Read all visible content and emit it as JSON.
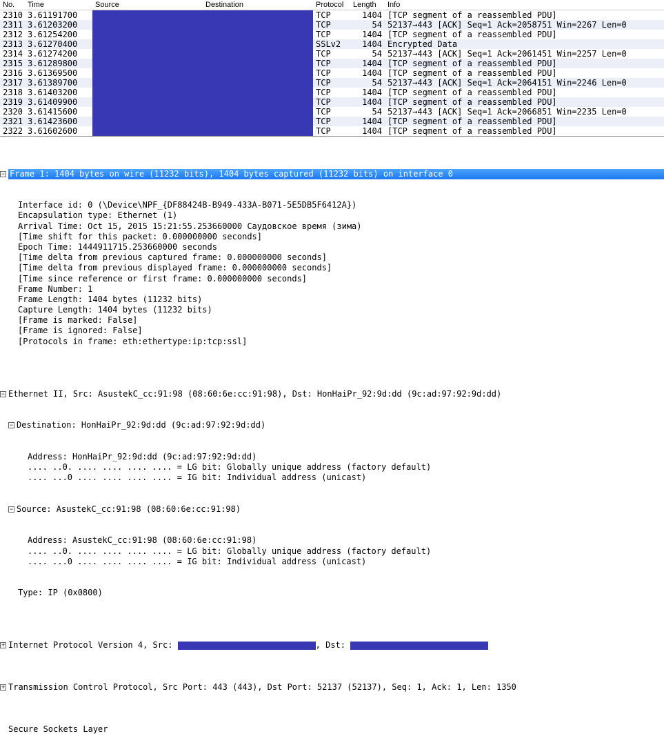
{
  "columns": {
    "no": "No.",
    "time": "Time",
    "source": "Source",
    "destination": "Destination",
    "protocol": "Protocol",
    "length": "Length",
    "info": "Info"
  },
  "packets": [
    {
      "no": "2310",
      "time": "3.61191700",
      "proto": "TCP",
      "len": "1404",
      "info": "[TCP segment of a reassembled PDU]"
    },
    {
      "no": "2311",
      "time": "3.61203200",
      "proto": "TCP",
      "len": "54",
      "info": "52137→443 [ACK] Seq=1 Ack=2058751 Win=2267 Len=0"
    },
    {
      "no": "2312",
      "time": "3.61254200",
      "proto": "TCP",
      "len": "1404",
      "info": "[TCP segment of a reassembled PDU]"
    },
    {
      "no": "2313",
      "time": "3.61270400",
      "proto": "SSLv2",
      "len": "1404",
      "info": "Encrypted Data"
    },
    {
      "no": "2314",
      "time": "3.61274200",
      "proto": "TCP",
      "len": "54",
      "info": "52137→443 [ACK] Seq=1 Ack=2061451 Win=2257 Len=0"
    },
    {
      "no": "2315",
      "time": "3.61289800",
      "proto": "TCP",
      "len": "1404",
      "info": "[TCP segment of a reassembled PDU]"
    },
    {
      "no": "2316",
      "time": "3.61369500",
      "proto": "TCP",
      "len": "1404",
      "info": "[TCP segment of a reassembled PDU]"
    },
    {
      "no": "2317",
      "time": "3.61389700",
      "proto": "TCP",
      "len": "54",
      "info": "52137→443 [ACK] Seq=1 Ack=2064151 Win=2246 Len=0"
    },
    {
      "no": "2318",
      "time": "3.61403200",
      "proto": "TCP",
      "len": "1404",
      "info": "[TCP segment of a reassembled PDU]"
    },
    {
      "no": "2319",
      "time": "3.61409900",
      "proto": "TCP",
      "len": "1404",
      "info": "[TCP segment of a reassembled PDU]"
    },
    {
      "no": "2320",
      "time": "3.61415600",
      "proto": "TCP",
      "len": "54",
      "info": "52137→443 [ACK] Seq=1 Ack=2066851 Win=2235 Len=0"
    },
    {
      "no": "2321",
      "time": "3.61423600",
      "proto": "TCP",
      "len": "1404",
      "info": "[TCP segment of a reassembled PDU]"
    },
    {
      "no": "2322",
      "time": "3.61602600",
      "proto": "TCP",
      "len": "1404",
      "info": "[TCP seqment of a reassembled PDU]"
    }
  ],
  "details": {
    "frame_header": "Frame 1: 1404 bytes on wire (11232 bits), 1404 bytes captured (11232 bits) on interface 0",
    "frame_lines": [
      "Interface id: 0 (\\Device\\NPF_{DF88424B-B949-433A-B071-5E5DB5F6412A})",
      "Encapsulation type: Ethernet (1)",
      "Arrival Time: Oct 15, 2015 15:21:55.253660000 Саудовское время (зима)",
      "[Time shift for this packet: 0.000000000 seconds]",
      "Epoch Time: 1444911715.253660000 seconds",
      "[Time delta from previous captured frame: 0.000000000 seconds]",
      "[Time delta from previous displayed frame: 0.000000000 seconds]",
      "[Time since reference or first frame: 0.000000000 seconds]",
      "Frame Number: 1",
      "Frame Length: 1404 bytes (11232 bits)",
      "Capture Length: 1404 bytes (11232 bits)",
      "[Frame is marked: False]",
      "[Frame is ignored: False]",
      "[Protocols in frame: eth:ethertype:ip:tcp:ssl]"
    ],
    "eth_header": "Ethernet II, Src: AsustekC_cc:91:98 (08:60:6e:cc:91:98), Dst: HonHaiPr_92:9d:dd (9c:ad:97:92:9d:dd)",
    "eth_dst_header": "Destination: HonHaiPr_92:9d:dd (9c:ad:97:92:9d:dd)",
    "eth_dst_lines": [
      "Address: HonHaiPr_92:9d:dd (9c:ad:97:92:9d:dd)",
      ".... ..0. .... .... .... .... = LG bit: Globally unique address (factory default)",
      ".... ...0 .... .... .... .... = IG bit: Individual address (unicast)"
    ],
    "eth_src_header": "Source: AsustekC_cc:91:98 (08:60:6e:cc:91:98)",
    "eth_src_lines": [
      "Address: AsustekC_cc:91:98 (08:60:6e:cc:91:98)",
      ".... ..0. .... .... .... .... = LG bit: Globally unique address (factory default)",
      ".... ...0 .... .... .... .... = IG bit: Individual address (unicast)"
    ],
    "eth_type": "Type: IP (0x0800)",
    "ip_prefix": "Internet Protocol Version 4, Src: ",
    "ip_mid": ", Dst: ",
    "tcp": "Transmission Control Protocol, Src Port: 443 (443), Dst Port: 52137 (52137), Seq: 1, Ack: 1, Len: 1350",
    "ssl": "Secure Sockets Layer"
  }
}
